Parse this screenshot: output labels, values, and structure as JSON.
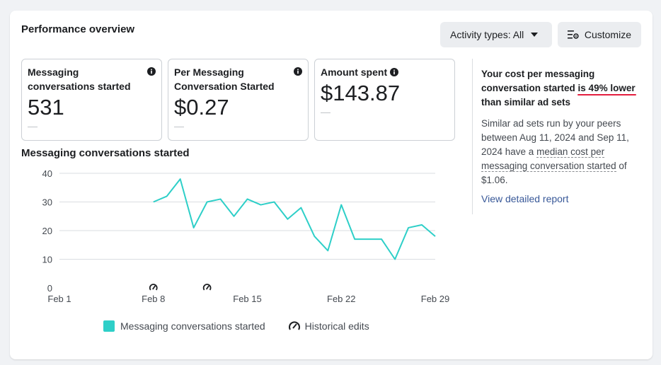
{
  "header": {
    "title": "Performance overview",
    "activity_button": "Activity types: All",
    "customize_button": "Customize"
  },
  "metrics": [
    {
      "label": "Messaging conversations started",
      "value": "531",
      "delta": "—"
    },
    {
      "label": "Per Messaging Conversation Started",
      "value": "$0.27",
      "delta": "—"
    },
    {
      "label": "Amount spent",
      "value": "$143.87",
      "delta": "—"
    }
  ],
  "insight": {
    "head_pre": "Your cost per messaging conversation started ",
    "head_highlight": "is 49% lower",
    "head_post": " than similar ad sets",
    "body_pre": "Similar ad sets run by your peers between Aug 11, 2024 and Sep 11, 2024 have a ",
    "body_dotted": "median cost per messaging conversation started",
    "body_post": " of $1.06.",
    "link": "View detailed report"
  },
  "chart_title": "Messaging conversations started",
  "legend": {
    "series": "Messaging conversations started",
    "edits": "Historical edits"
  },
  "colors": {
    "line": "#2ecfc8",
    "accent_underline": "#e41e3f",
    "link": "#385898"
  },
  "chart_data": {
    "type": "line",
    "title": "Messaging conversations started",
    "x_ticks": [
      "Feb 1",
      "Feb 8",
      "Feb 15",
      "Feb 22",
      "Feb 29"
    ],
    "x_tick_days": [
      1,
      8,
      15,
      22,
      29
    ],
    "y_ticks": [
      0,
      10,
      20,
      30,
      40
    ],
    "ylim": [
      0,
      40
    ],
    "xlim": [
      1,
      29
    ],
    "series": [
      {
        "name": "Messaging conversations started",
        "x": [
          8,
          9,
          10,
          11,
          12,
          13,
          14,
          15,
          16,
          17,
          18,
          19,
          20,
          21,
          22,
          23,
          24,
          25,
          26,
          27,
          28,
          29
        ],
        "y": [
          30,
          32,
          38,
          21,
          30,
          31,
          25,
          31,
          29,
          30,
          24,
          28,
          18,
          13,
          29,
          17,
          17,
          17,
          10,
          21,
          22,
          18
        ]
      }
    ],
    "historical_edits_x": [
      8,
      12
    ],
    "grid": true
  }
}
